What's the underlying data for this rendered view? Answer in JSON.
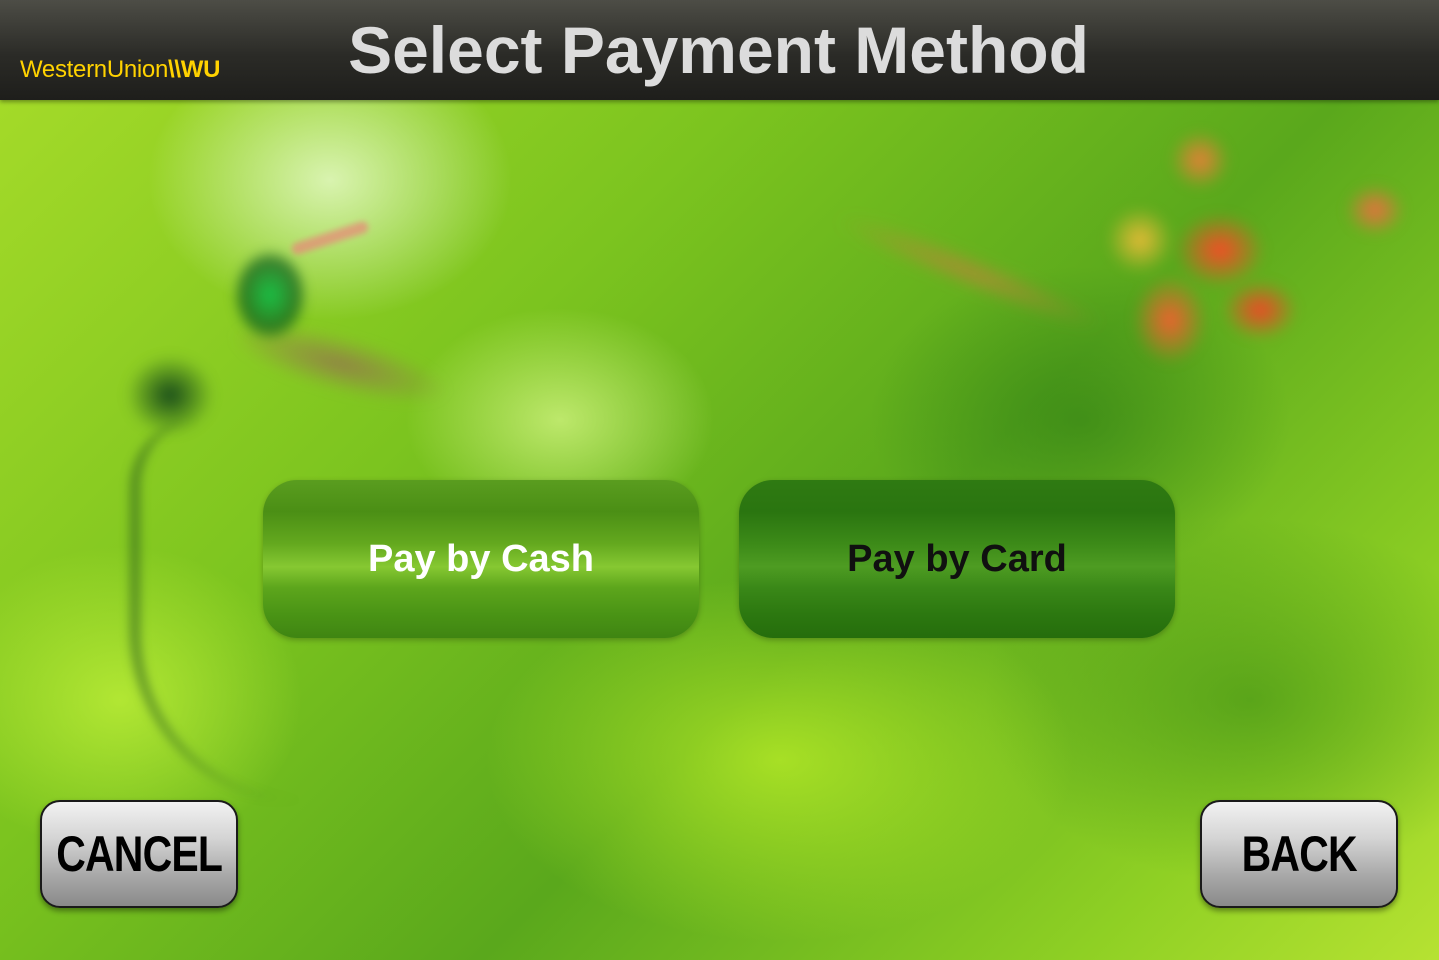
{
  "header": {
    "logo_text": "WesternUnion",
    "logo_mark": "\\\\WU",
    "title": "Select Payment Method"
  },
  "payment_options": {
    "cash_label": "Pay by Cash",
    "card_label": "Pay by Card"
  },
  "navigation": {
    "cancel_label": "CANCEL",
    "back_label": "BACK"
  },
  "colors": {
    "header_bg": "#2b2b27",
    "logo_yellow": "#ffd200",
    "title_text": "#dcdcdc",
    "cash_button": "#5da61c",
    "card_button": "#2f7a12",
    "nav_button": "#c8c8c8"
  }
}
